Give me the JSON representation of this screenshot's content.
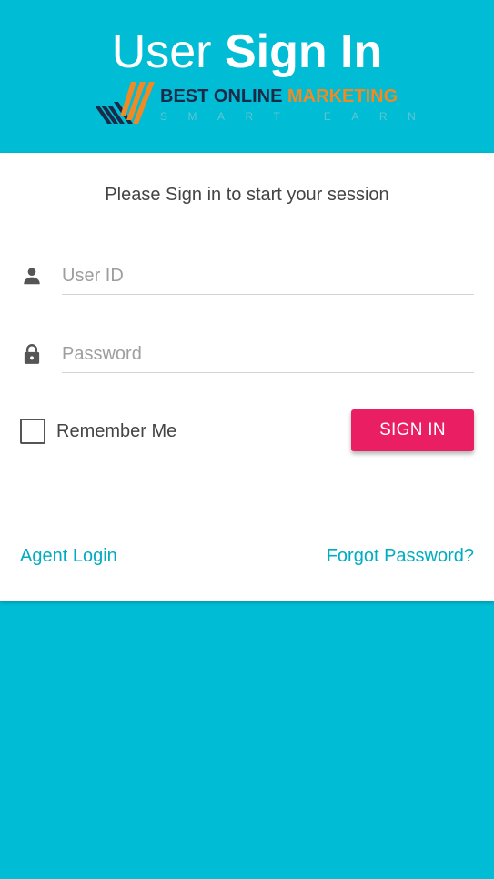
{
  "header": {
    "title_light": "User",
    "title_bold": "Sign In",
    "logo": {
      "brand_best_online": "BEST ONLINE",
      "brand_marketing": "MARKETING",
      "tagline": "SMART EARN"
    }
  },
  "card": {
    "subtitle": "Please Sign in to start your session",
    "user_id": {
      "placeholder": "User ID",
      "value": "",
      "icon": "person-icon"
    },
    "password": {
      "placeholder": "Password",
      "value": "",
      "icon": "lock-icon"
    },
    "remember_me": {
      "label": "Remember Me",
      "checked": false
    },
    "sign_in_label": "SIGN IN",
    "agent_login_label": "Agent Login",
    "forgot_password_label": "Forgot Password?"
  },
  "colors": {
    "background": "#00BCD4",
    "card": "#FFFFFF",
    "accent_button": "#E91E63",
    "link": "#00ACC1",
    "logo_navy": "#1A2B4A",
    "logo_orange": "#F08A24"
  }
}
